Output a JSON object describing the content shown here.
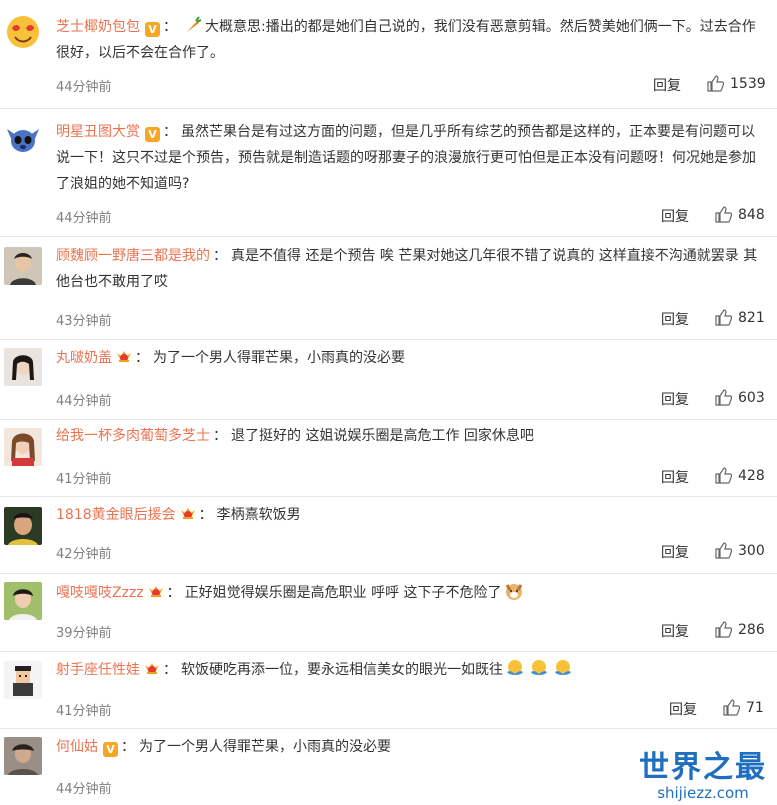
{
  "comments": [
    {
      "username": "芝士椰奶包包",
      "badge": "V",
      "text": "大概意思:播出的都是她们自己说的，我们没有恶意剪辑。然后赞美她们俩一下。过去合作很好，以后不会在合作了。",
      "time": "44分钟前",
      "reply": "回复",
      "likes": "1539"
    },
    {
      "username": "明星丑图大赏",
      "badge": "V",
      "text": "虽然芒果台是有过这方面的问题，但是几乎所有综艺的预告都是这样的，正本要是有问题可以说一下！这只不过是个预告，预告就是制造话题的呀那妻子的浪漫旅行更可怕但是正本没有问题呀！何况她是参加了浪姐的她不知道吗?",
      "time": "44分钟前",
      "reply": "回复",
      "likes": "848"
    },
    {
      "username": "顾魏顾一野唐三都是我的",
      "text": "真是不值得 还是个预告 唉 芒果对她这几年很不错了说真的 这样直接不沟通就罢录 其他台也不敢用了哎",
      "time": "43分钟前",
      "reply": "回复",
      "likes": "821"
    },
    {
      "username": "丸啵奶盖",
      "text": "为了一个男人得罪芒果，小雨真的没必要",
      "time": "44分钟前",
      "reply": "回复",
      "likes": "603"
    },
    {
      "username": "给我一杯多肉葡萄多芝士",
      "text": "退了挺好的 这姐说娱乐圈是高危工作 回家休息吧",
      "time": "41分钟前",
      "reply": "回复",
      "likes": "428"
    },
    {
      "username": "1818黄金眼后援会",
      "text": "李柄熹软饭男",
      "time": "42分钟前",
      "reply": "回复",
      "likes": "300"
    },
    {
      "username": "嘎吱嘎吱Zzzz",
      "text": "正好姐觉得娱乐圈是高危职业 呼呼 这下子不危险了",
      "time": "39分钟前",
      "reply": "回复",
      "likes": "286"
    },
    {
      "username": "射手座任性娃",
      "text": "软饭硬吃再添一位，要永远相信美女的眼光一如既往",
      "time": "41分钟前",
      "reply": "回复",
      "likes": "71"
    },
    {
      "username": "何仙姑",
      "badge": "V",
      "text": "为了一个男人得罪芒果，小雨真的没必要",
      "time": "44分钟前",
      "reply": "回复",
      "likes": ""
    }
  ],
  "watermark": {
    "title": "世界之最",
    "url": "shijiezz.com"
  },
  "colors": {
    "username": "#eb7350",
    "badge": "#f6a623",
    "meta": "#808080",
    "divider": "#e6e6e6",
    "watermark": "#1f6fc1"
  },
  "icons": {
    "like": "thumbs-up-icon",
    "crown": "fan-crown-icon",
    "verified": "verified-v-icon"
  }
}
